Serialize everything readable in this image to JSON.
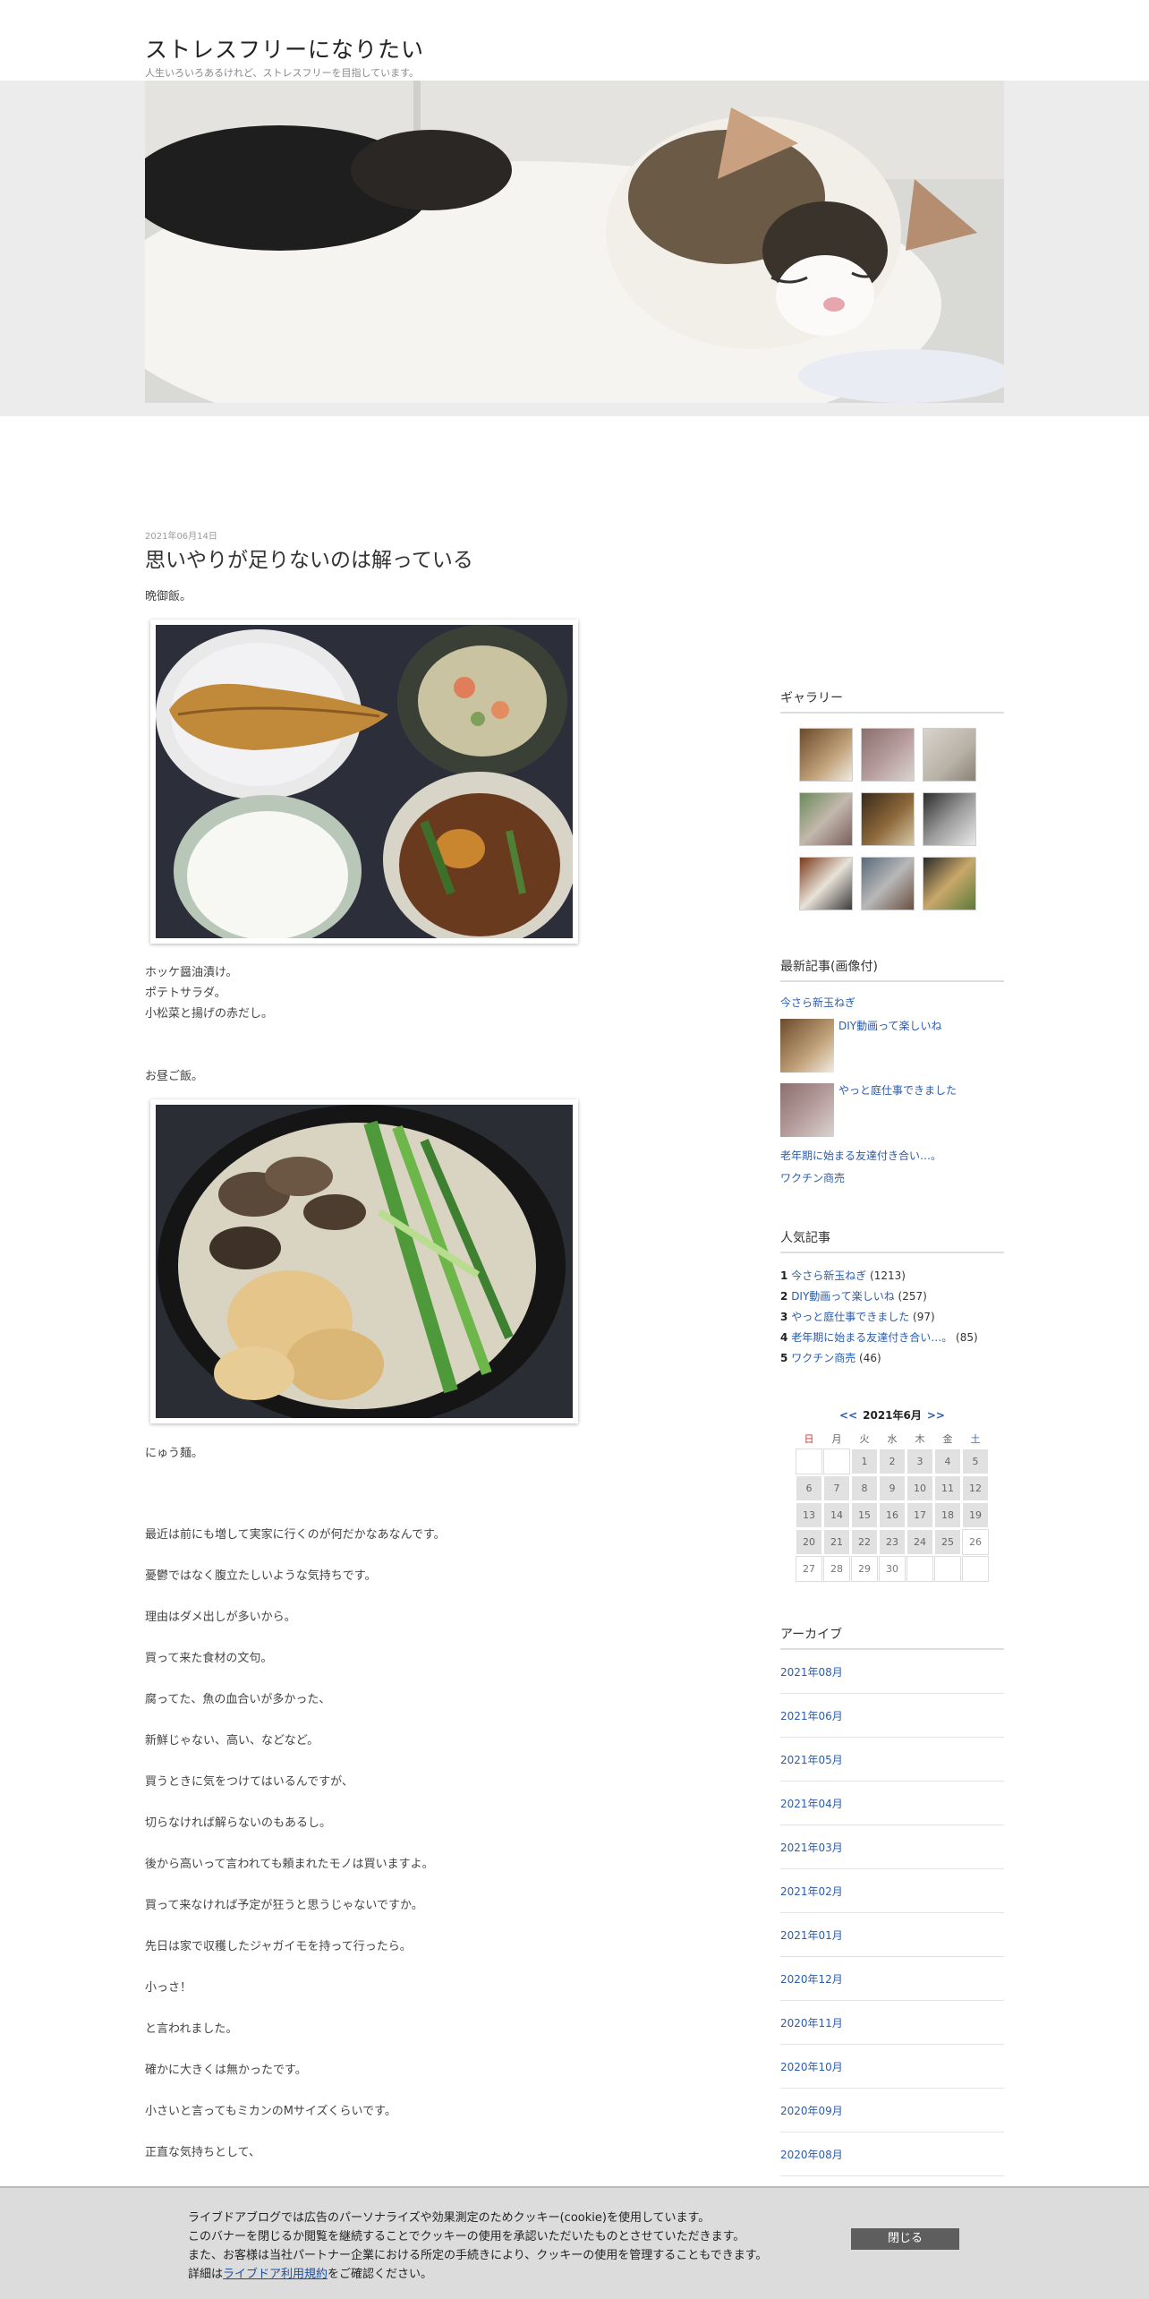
{
  "site": {
    "title": "ストレスフリーになりたい",
    "description": "人生いろいろあるけれど、ストレスフリーを目指しています。"
  },
  "post": {
    "date": "2021年06月14日",
    "title": "思いやりが足りないのは解っている",
    "intro": "晩御飯。",
    "dinner_lines": [
      "ホッケ醤油漬け。",
      "ポテトサラダ。",
      "小松菜と揚げの赤だし。"
    ],
    "lunch_intro": "お昼ご飯。",
    "lunch_caption": "にゅう麺。",
    "paragraphs": [
      "最近は前にも増して実家に行くのが何だかなあなんです。",
      "憂鬱ではなく腹立たしいような気持ちです。",
      "理由はダメ出しが多いから。",
      "買って来た食材の文句。",
      "腐ってた、魚の血合いが多かった、",
      "新鮮じゃない、高い、などなど。",
      "買うときに気をつけてはいるんですが、",
      "切らなければ解らないのもあるし。",
      "後から高いって言われても頼まれたモノは買いますよ。",
      "買って来なければ予定が狂うと思うじゃないですか。",
      "先日は家で収穫したジャガイモを持って行ったら。",
      "小っさ！",
      "と言われました。",
      "確かに大きくは無かったです。",
      "小さいと言ってもミカンのMサイズくらいです。",
      "正直な気持ちとして、"
    ]
  },
  "sidebar": {
    "gallery_heading": "ギャラリー",
    "recent_heading": "最新記事(画像付)",
    "recent": [
      "今さら新玉ねぎ",
      "DIY動画って楽しいね",
      "やっと庭仕事できました",
      "老年期に始まる友達付き合い…。",
      "ワクチン商売"
    ],
    "popular_heading": "人気記事",
    "popular": [
      {
        "rank": "1",
        "title": "今さら新玉ねぎ",
        "count": "(1213)"
      },
      {
        "rank": "2",
        "title": "DIY動画って楽しいね",
        "count": "(257)"
      },
      {
        "rank": "3",
        "title": "やっと庭仕事できました",
        "count": "(97)"
      },
      {
        "rank": "4",
        "title": "老年期に始まる友達付き合い…。",
        "count": "(85)"
      },
      {
        "rank": "5",
        "title": "ワクチン商売",
        "count": "(46)"
      }
    ],
    "calendar": {
      "prev": "<<",
      "month": "2021年6月",
      "next": ">>",
      "weekdays": [
        "日",
        "月",
        "火",
        "水",
        "木",
        "金",
        "土"
      ],
      "weeks": [
        [
          "",
          "",
          "1",
          "2",
          "3",
          "4",
          "5"
        ],
        [
          "6",
          "7",
          "8",
          "9",
          "10",
          "11",
          "12"
        ],
        [
          "13",
          "14",
          "15",
          "16",
          "17",
          "18",
          "19"
        ],
        [
          "20",
          "21",
          "22",
          "23",
          "24",
          "25",
          "26"
        ],
        [
          "27",
          "28",
          "29",
          "30",
          "",
          "",
          ""
        ]
      ]
    },
    "archive_heading": "アーカイブ",
    "archives": [
      "2021年08月",
      "2021年06月",
      "2021年05月",
      "2021年04月",
      "2021年03月",
      "2021年02月",
      "2021年01月",
      "2020年12月",
      "2020年11月",
      "2020年10月",
      "2020年09月",
      "2020年08月"
    ]
  },
  "cookie": {
    "line1": "ライブドアブログでは広告のパーソナライズや効果測定のためクッキー(cookie)を使用しています。",
    "line2": "このバナーを閉じるか閲覧を継続することでクッキーの使用を承認いただいたものとさせていただきます。",
    "line3": "また、お客様は当社パートナー企業における所定の手続きにより、クッキーの使用を管理することもできます。",
    "line4_pre": "詳細は",
    "line4_link": "ライブドア利用規約",
    "line4_post": "をご確認ください。",
    "close": "閉じる"
  }
}
